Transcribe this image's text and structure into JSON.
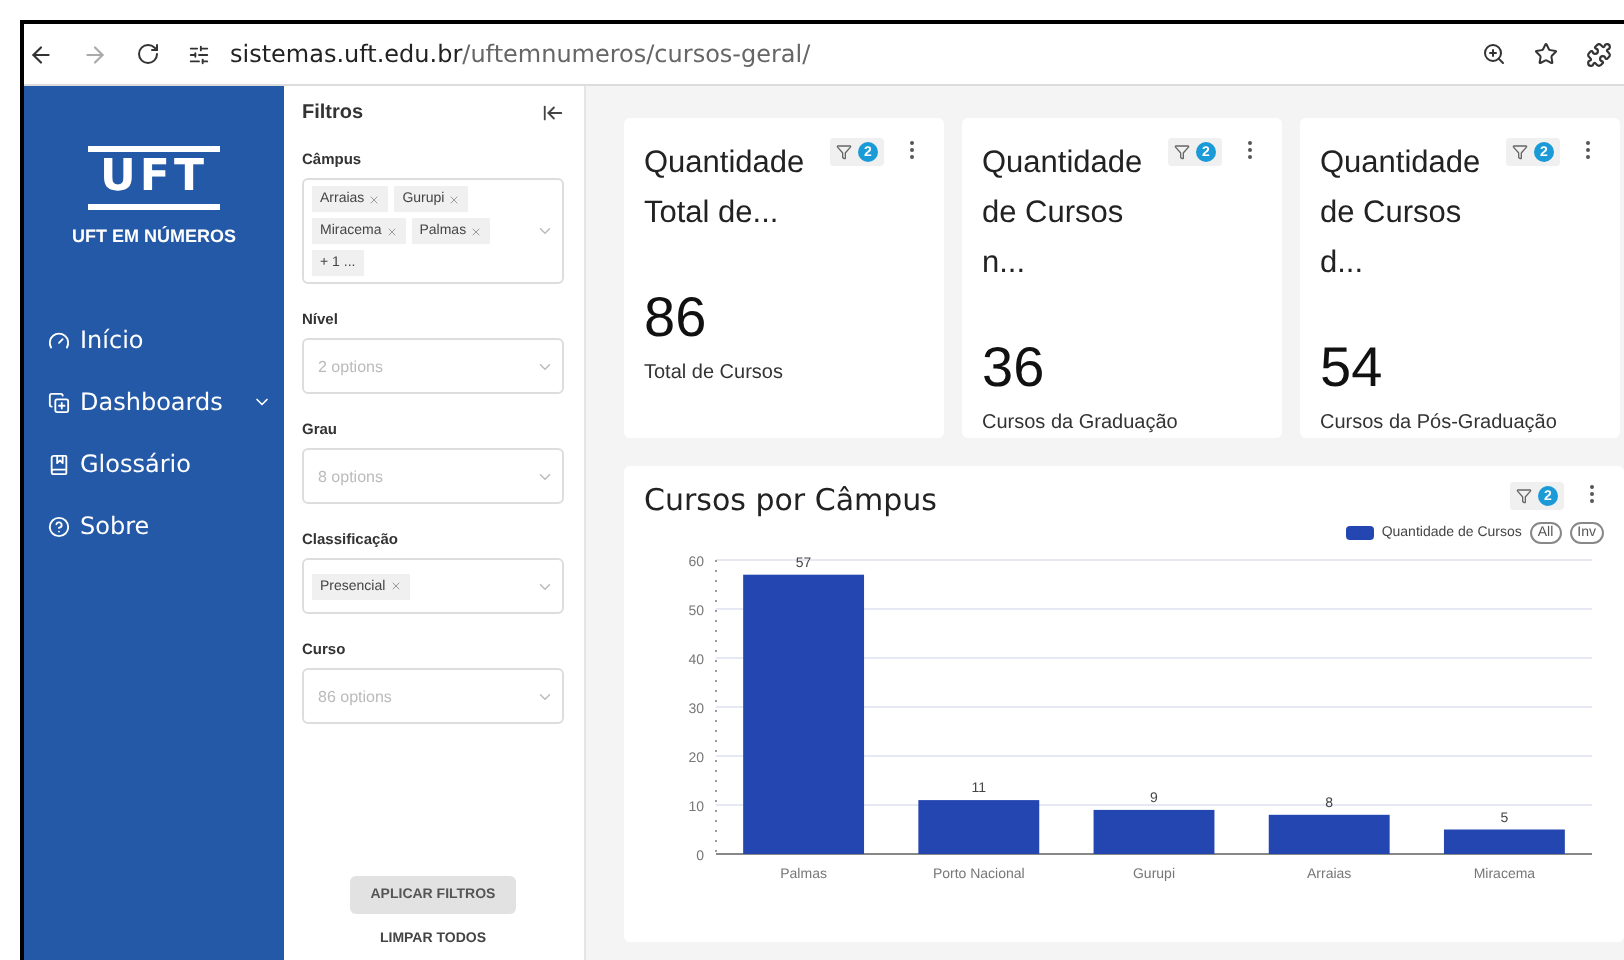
{
  "browser": {
    "url_host": "sistemas.uft.edu.br",
    "url_path": "/uftemnumeros/cursos-geral/"
  },
  "sidebar": {
    "logo": "UFT",
    "title": "UFT EM NÚMEROS",
    "items": [
      {
        "label": "Início",
        "kind": "home",
        "expandable": false
      },
      {
        "label": "Dashboards",
        "kind": "dashboards",
        "expandable": true
      },
      {
        "label": "Glossário",
        "kind": "glossary",
        "expandable": false
      },
      {
        "label": "Sobre",
        "kind": "about",
        "expandable": false
      }
    ]
  },
  "filters": {
    "title": "Filtros",
    "fields": [
      {
        "label": "Câmpus",
        "tags": [
          "Arraias",
          "Gurupi",
          "Miracema",
          "Palmas"
        ],
        "more": "+ 1 ..."
      },
      {
        "label": "Nível",
        "placeholder": "2 options"
      },
      {
        "label": "Grau",
        "placeholder": "8 options"
      },
      {
        "label": "Classificação",
        "tags": [
          "Presencial"
        ]
      },
      {
        "label": "Curso",
        "placeholder": "86 options"
      }
    ],
    "apply": "APLICAR FILTROS",
    "clear": "LIMPAR TODOS"
  },
  "cards": [
    {
      "title": "Quantidade Total de...",
      "filter_count": "2",
      "value": "86",
      "caption": "Total de Cursos"
    },
    {
      "title": "Quantidade de Cursos n...",
      "filter_count": "2",
      "value": "36",
      "caption": "Cursos da Graduação"
    },
    {
      "title": "Quantidade de Cursos d...",
      "filter_count": "2",
      "value": "54",
      "caption": "Cursos da Pós-Graduação"
    }
  ],
  "chart_panel": {
    "title": "Cursos por Câmpus",
    "filter_count": "2",
    "legend_all": "All",
    "legend_inv": "Inv",
    "chart_data": {
      "type": "bar",
      "categories": [
        "Palmas",
        "Porto Nacional",
        "Gurupi",
        "Arraias",
        "Miracema"
      ],
      "series": [
        {
          "name": "Quantidade de Cursos",
          "color": "#2446b0",
          "values": [
            57,
            11,
            9,
            8,
            5
          ]
        }
      ],
      "ylim": [
        0,
        60
      ],
      "grid": true,
      "yticks": [
        0,
        10,
        20,
        30,
        40,
        50,
        60
      ],
      "data_labels": true
    }
  }
}
